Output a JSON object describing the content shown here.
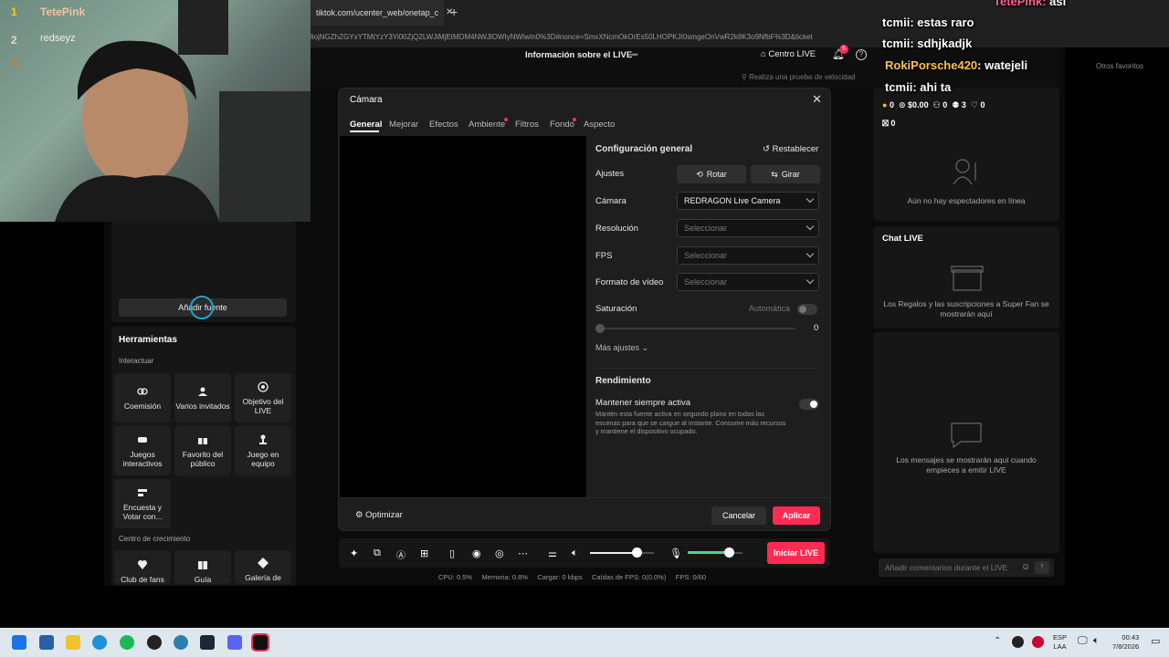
{
  "browser": {
    "tab_title": "tiktok.com/ucenter_web/onetap_c",
    "new_tab": "+",
    "url": "liojNGZhZGYxYTMtYzY3Yi00ZjQ2LWJiMjEtMDM4NWJlOWIyNWIwIn0%3D#nonce=SmxXNcmOkOrEs50LHOPKJI0smgeOnVwR2k8K3o9NfbF%3D&ticket"
  },
  "topbar": {
    "info_live": "Información sobre el LIVE",
    "centro_live": "Centro LIVE",
    "notif_count": "5",
    "speed_test": "Realiza una prueba de velocidad",
    "otros_favoritos": "Otros favoritos"
  },
  "webcam_overlay": {
    "ranks": [
      {
        "rank": "1",
        "name": "TetePink"
      },
      {
        "rank": "2",
        "name": "redseyz"
      },
      {
        "rank": "3",
        "name": ""
      }
    ]
  },
  "left": {
    "add_source": "Añadir fuente",
    "tools_title": "Herramientas",
    "interact_label": "Interactuar",
    "tools": [
      {
        "label": "Coemisión",
        "icon": "link-icon"
      },
      {
        "label": "Varios invitados",
        "icon": "users-icon"
      },
      {
        "label": "Objetivo del LIVE",
        "icon": "target-icon"
      },
      {
        "label": "Juegos interactivos",
        "icon": "gamepad-icon"
      },
      {
        "label": "Favorito del público",
        "icon": "gift-icon"
      },
      {
        "label": "Juego en equipo",
        "icon": "joystick-icon"
      },
      {
        "label": "Encuesta y Votar con...",
        "icon": "poll-icon"
      }
    ],
    "growth_label": "Centro de crecimiento",
    "growth": [
      {
        "label": "Club de fans"
      },
      {
        "label": "Guía"
      },
      {
        "label": "Galería de"
      }
    ]
  },
  "modal": {
    "title": "Cámara",
    "tabs": [
      "General",
      "Mejorar",
      "Efectos",
      "Ambiente",
      "Filtros",
      "Fondo",
      "Aspecto"
    ],
    "active_tab": "General",
    "section_title": "Configuración general",
    "reset": "Restablecer",
    "ajustes": "Ajustes",
    "rotar": "Rotar",
    "girar": "Girar",
    "camara_label": "Cámara",
    "camara_value": "REDRAGON Live Camera",
    "resolucion_label": "Resolución",
    "resolucion_value": "Seleccionar",
    "fps_label": "FPS",
    "fps_value": "Seleccionar",
    "formato_label": "Formato de vídeo",
    "formato_value": "Seleccionar",
    "saturacion_label": "Saturación",
    "automatica": "Automática",
    "saturacion_value": "0",
    "more": "Más ajustes",
    "rendimiento": "Rendimiento",
    "keep_active": "Mantener siempre activa",
    "keep_active_desc": "Mantén esta fuente activa en segundo plano en todas las escenas para que se cargue al instante. Consume más recursos y mantiene el dispositivo ocupado.",
    "optimize": "Optimizar",
    "cancel": "Cancelar",
    "apply": "Aplicar"
  },
  "controls": {
    "start_live": "Iniciar LIVE",
    "volume_level": 0.73,
    "mic_level": 0.75
  },
  "stats": {
    "cpu": "CPU: 0.5%",
    "memory": "Memoria: 0.8%",
    "upload": "Cargar: 0 kbps",
    "fps_drops": "Caídas de FPS: 0(0.0%)",
    "fps": "FPS: 0/60"
  },
  "right": {
    "stats": {
      "coins": "0",
      "money": "$0.00",
      "viewers": "0",
      "followers": "3",
      "likes": "0",
      "gifts": "0"
    },
    "no_viewers": "Aún no hay espectadores en línea",
    "chat_title": "Chat LIVE",
    "gifts_msg": "Los Regalos y las suscripciones a Super Fan se mostrarán aquí",
    "messages_msg": "Los mensajes se mostrarán aquí cuando empieces a emitir LIVE",
    "comment_placeholder": "Añadir comentarios durante el LIVE"
  },
  "overlay_chat": [
    {
      "user": "TetePink",
      "msg": "asi"
    },
    {
      "user": "tcmii",
      "msg": "estas raro"
    },
    {
      "user": "tcmii",
      "msg": "sdhjkadjk"
    },
    {
      "user": "RokiPorsche420",
      "msg": "watejeli"
    },
    {
      "user": "tcmii",
      "msg": "ahi ta"
    }
  ],
  "taskbar": {
    "lang": "ESP",
    "lang2": "LAA",
    "time": "00:43",
    "date": "7/8/2026"
  },
  "colors": {
    "accent": "#fe2c55",
    "green": "#3ddc84"
  }
}
